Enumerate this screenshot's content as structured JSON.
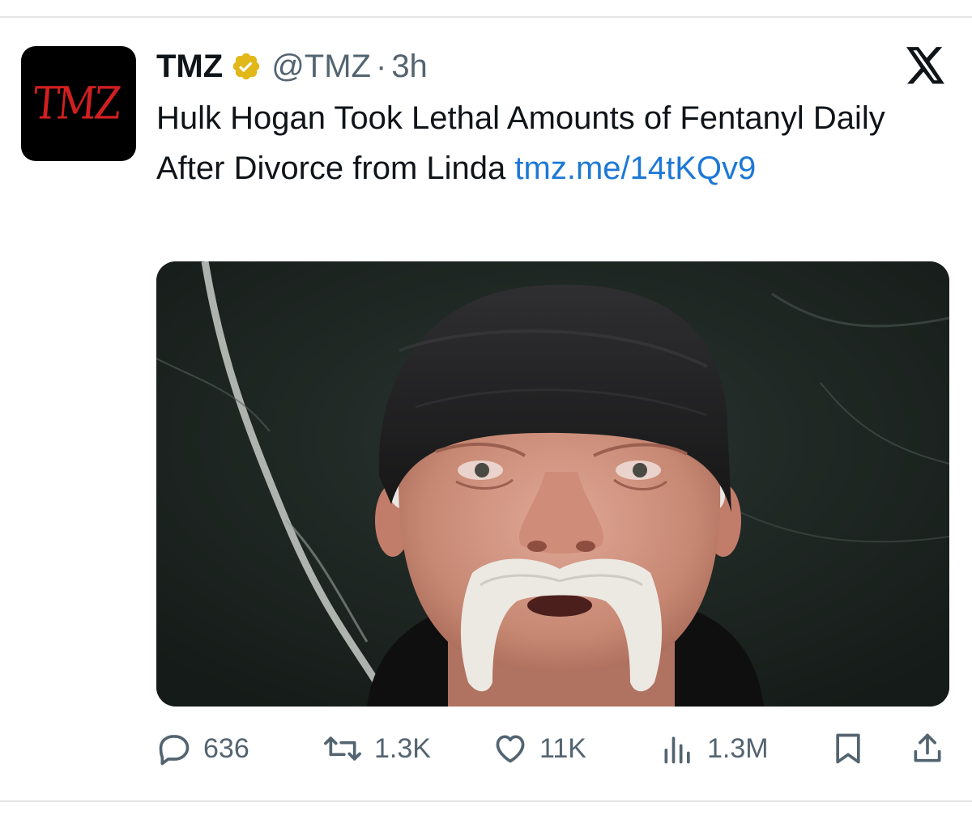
{
  "tweet": {
    "display_name": "TMZ",
    "handle": "@TMZ",
    "separator": "·",
    "time": "3h",
    "avatar_text": "TMZ",
    "text_main": "Hulk Hogan Took Lethal Amounts of Fentanyl Daily After Divorce from Linda ",
    "link_text": "tmz.me/​14tKQv9"
  },
  "media": {
    "icon": "photo-of-man-in-black-bandana"
  },
  "actions": {
    "replies": "636",
    "reposts": "1.3K",
    "likes": "11K",
    "views": "1.3M"
  },
  "colors": {
    "link": "#1d78d6",
    "muted": "#536471",
    "verified_gold": "#e2b719",
    "brand_red": "#d21f1f"
  },
  "icons": [
    "verified-badge-icon",
    "x-logo-icon",
    "reply-icon",
    "repost-icon",
    "like-icon",
    "views-icon",
    "bookmark-icon",
    "share-icon"
  ]
}
